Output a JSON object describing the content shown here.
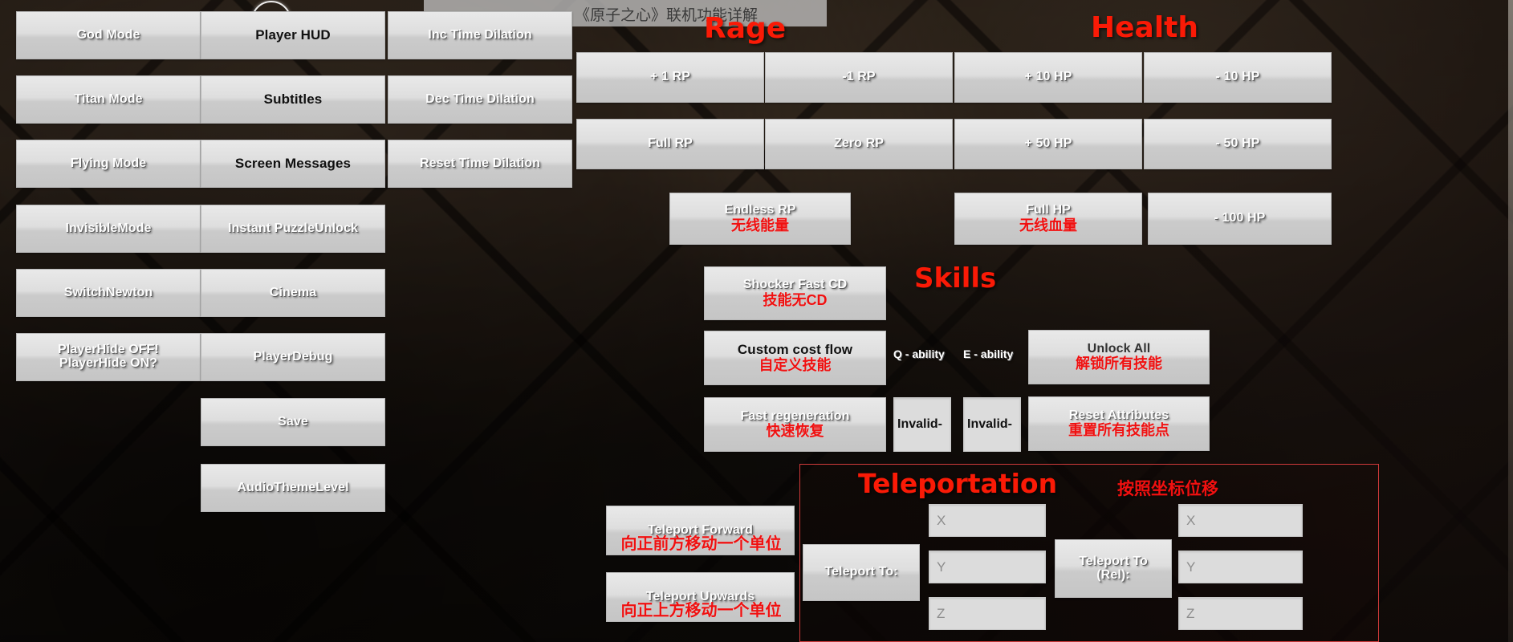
{
  "window": {
    "title": "《原子之心》联机功能详解",
    "cursor": "crosshair-cursor"
  },
  "panels": {
    "player_column": {
      "name": "Player cheats column",
      "buttons": [
        {
          "en": "God Mode"
        },
        {
          "en": "Titan Mode"
        },
        {
          "en": "Flying Mode"
        },
        {
          "en": "InvisibleMode"
        },
        {
          "en": "SwitchNewton"
        },
        {
          "en": "PlayerHide OFF!\nPlayerHide ON?"
        }
      ]
    },
    "hud_column": {
      "name": "HUD and debug column",
      "buttons": [
        {
          "en": "Player HUD",
          "dark": true
        },
        {
          "en": "Subtitles",
          "dark": true
        },
        {
          "en": "Screen Messages",
          "dark": true
        },
        {
          "en": "Instant PuzzleUnlock"
        },
        {
          "en": "Cinema"
        },
        {
          "en": "PlayerDebug"
        },
        {
          "en": "Save"
        },
        {
          "en": "AudioThemeLevel"
        }
      ]
    },
    "time_column": {
      "name": "Time dilation column",
      "buttons": [
        {
          "en": "Inc Time Dilation"
        },
        {
          "en": "Dec Time Dilation"
        },
        {
          "en": "Reset Time Dilation"
        }
      ]
    },
    "rage": {
      "heading": "Rage",
      "buttons": [
        {
          "en": "+ 1 RP"
        },
        {
          "en": "-1 RP"
        },
        {
          "en": "Full RP"
        },
        {
          "en": "Zero RP"
        },
        {
          "en": "Endless RP",
          "cn": "无线能量"
        }
      ]
    },
    "health": {
      "heading": "Health",
      "buttons": [
        {
          "en": "+ 10 HP"
        },
        {
          "en": "- 10 HP"
        },
        {
          "en": "+ 50 HP"
        },
        {
          "en": "- 50 HP"
        },
        {
          "en": "Full HP",
          "cn": "无线血量"
        },
        {
          "en": "- 100 HP"
        }
      ]
    },
    "skills": {
      "heading": "Skills",
      "buttons": [
        {
          "en": "Shocker Fast CD",
          "cn": "技能无CD"
        },
        {
          "en": "Custom cost flow",
          "cn": "自定义技能",
          "dark": true
        },
        {
          "en": "Fast regeneration",
          "cn": "快速恢复"
        },
        {
          "en": "Unlock All",
          "cn": "解锁所有技能"
        },
        {
          "en": "Reset Attributes",
          "cn": "重置所有技能点"
        }
      ],
      "ability_labels": [
        "Q - ability",
        "E - ability"
      ],
      "ability_fields": [
        {
          "value": "Invalid-"
        },
        {
          "value": "Invalid-"
        }
      ]
    },
    "teleport": {
      "heading": "Teleportation",
      "note": "按照坐标位移",
      "move_buttons": [
        {
          "en": "Teleport Forward",
          "cn": "向正前方移动一个单位"
        },
        {
          "en": "Teleport Upwards",
          "cn": "向正上方移动一个单位"
        }
      ],
      "absolute": {
        "label": "Teleport To:",
        "fields": [
          {
            "placeholder": "X",
            "value": ""
          },
          {
            "placeholder": "Y",
            "value": ""
          },
          {
            "placeholder": "Z",
            "value": ""
          }
        ]
      },
      "relative": {
        "label": "Teleport To\n(Rel):",
        "fields": [
          {
            "placeholder": "X",
            "value": ""
          },
          {
            "placeholder": "Y",
            "value": ""
          },
          {
            "placeholder": "Z",
            "value": ""
          }
        ]
      }
    }
  },
  "colors": {
    "heading_red": "#fa1a06",
    "note_red": "#f01010",
    "button_face": "#dedede",
    "field_face": "#dcdcdc"
  }
}
